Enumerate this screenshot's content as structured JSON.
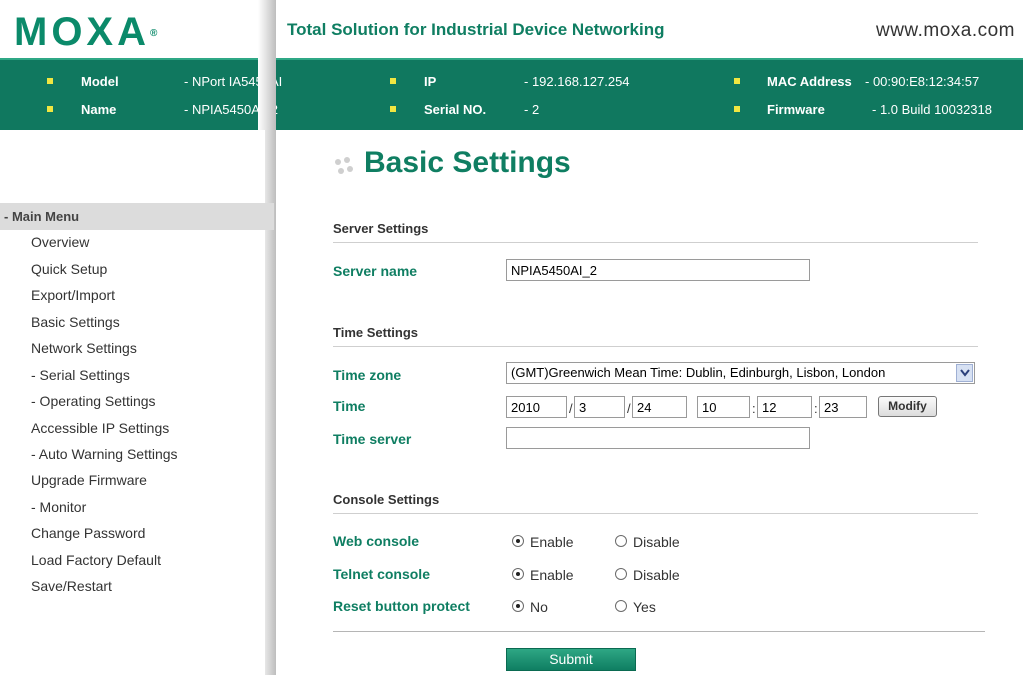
{
  "header": {
    "logo_text": "MOXA",
    "logo_mark": "®",
    "tagline": "Total Solution for Industrial Device Networking",
    "website": "www.moxa.com"
  },
  "device_info": {
    "model_label": "Model",
    "model_value": "- NPort IA5450AI",
    "name_label": "Name",
    "name_value": "- NPIA5450AI_2",
    "ip_label": "IP",
    "ip_value": "- 192.168.127.254",
    "serial_label": "Serial NO.",
    "serial_value": "- 2",
    "mac_label": "MAC Address",
    "mac_value": "- 00:90:E8:12:34:57",
    "firmware_label": "Firmware",
    "firmware_value": "- 1.0 Build 10032318"
  },
  "sidebar": {
    "header": "- Main Menu",
    "items": [
      "Overview",
      "Quick Setup",
      "Export/Import",
      "Basic Settings",
      "Network Settings",
      "- Serial Settings",
      "- Operating Settings",
      "Accessible IP Settings",
      "- Auto Warning Settings",
      "Upgrade Firmware",
      "- Monitor",
      "Change Password",
      "Load Factory Default",
      "Save/Restart"
    ]
  },
  "main": {
    "title": "Basic Settings",
    "server_section": "Server Settings",
    "server_name_label": "Server name",
    "server_name_value": "NPIA5450AI_2",
    "time_section": "Time Settings",
    "time_zone_label": "Time zone",
    "time_zone_value": "(GMT)Greenwich Mean Time: Dublin, Edinburgh, Lisbon, London",
    "time_label": "Time",
    "time_year": "2010",
    "time_month": "3",
    "time_day": "24",
    "time_hour": "10",
    "time_minute": "12",
    "time_second": "23",
    "date_sep": "/",
    "time_sep": ":",
    "modify_label": "Modify",
    "time_server_label": "Time server",
    "time_server_value": "",
    "console_section": "Console Settings",
    "web_console_label": "Web console",
    "telnet_console_label": "Telnet console",
    "reset_protect_label": "Reset button protect",
    "enable_label": "Enable",
    "disable_label": "Disable",
    "no_label": "No",
    "yes_label": "Yes",
    "submit_label": "Submit"
  },
  "colors": {
    "brand_green": "#0f7e62",
    "band_green": "#10785f",
    "bullet_yellow": "#f0e641"
  }
}
